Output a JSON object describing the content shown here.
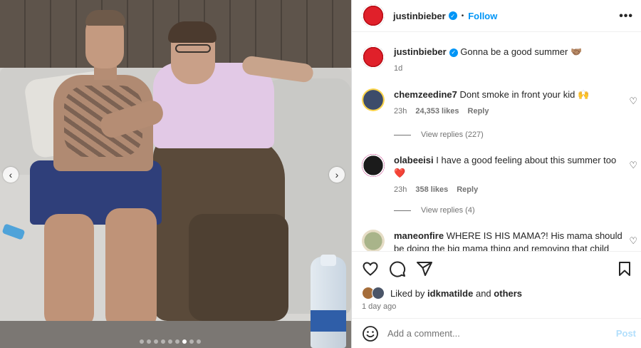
{
  "carousel": {
    "prev_icon": "chevron-left-icon",
    "next_icon": "chevron-right-icon",
    "slide_count": 9,
    "active_slide": 7
  },
  "header": {
    "username": "justinbieber",
    "separator": "•",
    "follow_label": "Follow",
    "more_label": "•••"
  },
  "caption": {
    "username": "justinbieber",
    "text": "Gonna be a good summer 🤝🏽",
    "time": "1d"
  },
  "comments": [
    {
      "username": "chemzeedine7",
      "text": "Dont smoke in front your kid 🙌",
      "time": "23h",
      "likes": "24,353 likes",
      "reply_label": "Reply",
      "view_replies": "View replies (227)"
    },
    {
      "username": "olabeeisi",
      "text": "I have a good feeling about this summer too ❤️",
      "time": "23h",
      "likes": "358 likes",
      "reply_label": "Reply",
      "view_replies": "View replies (4)"
    },
    {
      "username": "maneonfire",
      "text": "WHERE IS HIS MAMA?! His mama should be doing the big mama thing and removing that child from"
    }
  ],
  "actions": {
    "like_icon": "heart-icon",
    "comment_icon": "comment-icon",
    "share_icon": "share-icon",
    "save_icon": "bookmark-icon"
  },
  "likes": {
    "prefix": "Liked by",
    "user": "idkmatilde",
    "and_label": "and",
    "others": "others",
    "time_ago": "1 day ago"
  },
  "add_comment": {
    "placeholder": "Add a comment...",
    "post_label": "Post"
  },
  "colors": {
    "accent": "#0095f6",
    "post_disabled": "#b2dffc",
    "muted": "#737373"
  }
}
